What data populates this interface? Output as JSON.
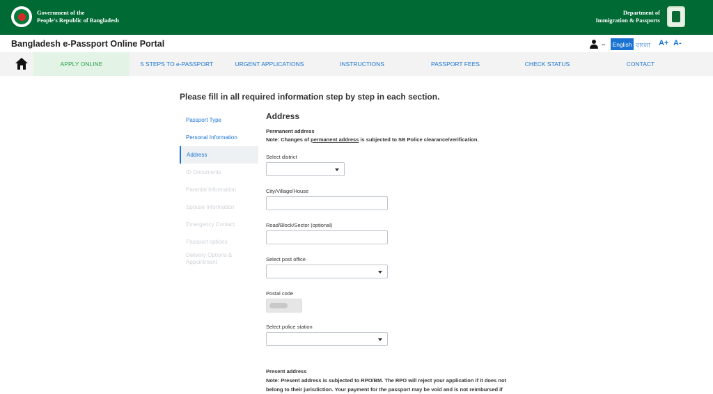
{
  "gov_header": {
    "left_line1": "Government of the",
    "left_line2": "People's Republic of Bangladesh",
    "right_line1": "Department of",
    "right_line2": "Immigration & Passports"
  },
  "title_bar": {
    "portal_title": "Bangladesh e-Passport Online Portal",
    "lang_english": "English",
    "lang_bangla": "বাংলা",
    "font_increase": "A+",
    "font_decrease": "A-"
  },
  "nav": {
    "items": [
      {
        "label": "APPLY ONLINE",
        "active": true
      },
      {
        "label": "5 STEPS TO e-PASSPORT"
      },
      {
        "label": "URGENT APPLICATIONS"
      },
      {
        "label": "INSTRUCTIONS"
      },
      {
        "label": "PASSPORT FEES"
      },
      {
        "label": "CHECK STATUS"
      },
      {
        "label": "CONTACT"
      }
    ]
  },
  "instruction": "Please fill in all required information step by step in each section.",
  "steps": [
    {
      "label": "Passport Type",
      "state": "done"
    },
    {
      "label": "Personal Information",
      "state": "done"
    },
    {
      "label": "Address",
      "state": "current"
    },
    {
      "label": "ID Documents",
      "state": "disabled"
    },
    {
      "label": "Parental Information",
      "state": "disabled"
    },
    {
      "label": "Spouse Information",
      "state": "disabled"
    },
    {
      "label": "Emergency Contact",
      "state": "disabled"
    },
    {
      "label": "Passport options",
      "state": "disabled"
    },
    {
      "label": "Delivery Options & Appointment",
      "state": "disabled"
    }
  ],
  "form": {
    "section_title": "Address",
    "permanent_title": "Permanent address",
    "permanent_note_prefix": "Note: Changes of ",
    "permanent_note_link": "permanent address",
    "permanent_note_suffix": " is subjected to SB Police clearance/verification.",
    "fields": {
      "district_label": "Select district",
      "district_value": "",
      "city_label": "City/Village/House",
      "city_value": "",
      "road_label": "Road/Block/Sector (optional)",
      "road_value": "",
      "post_office_label": "Select post office",
      "post_office_value": "",
      "postal_code_label": "Postal code",
      "police_station_label": "Select police station",
      "police_station_value": ""
    },
    "present_title": "Present address",
    "present_note": "Note: Present address is subjected to RPO/BM. The RPO will reject your application if it does not belong to their jurisdiction. Your payment for the passport may be void and is not reimbursed if"
  },
  "colors": {
    "header_green": "#006a35",
    "link_blue": "#1b73d1",
    "active_green": "#2aa04a"
  }
}
